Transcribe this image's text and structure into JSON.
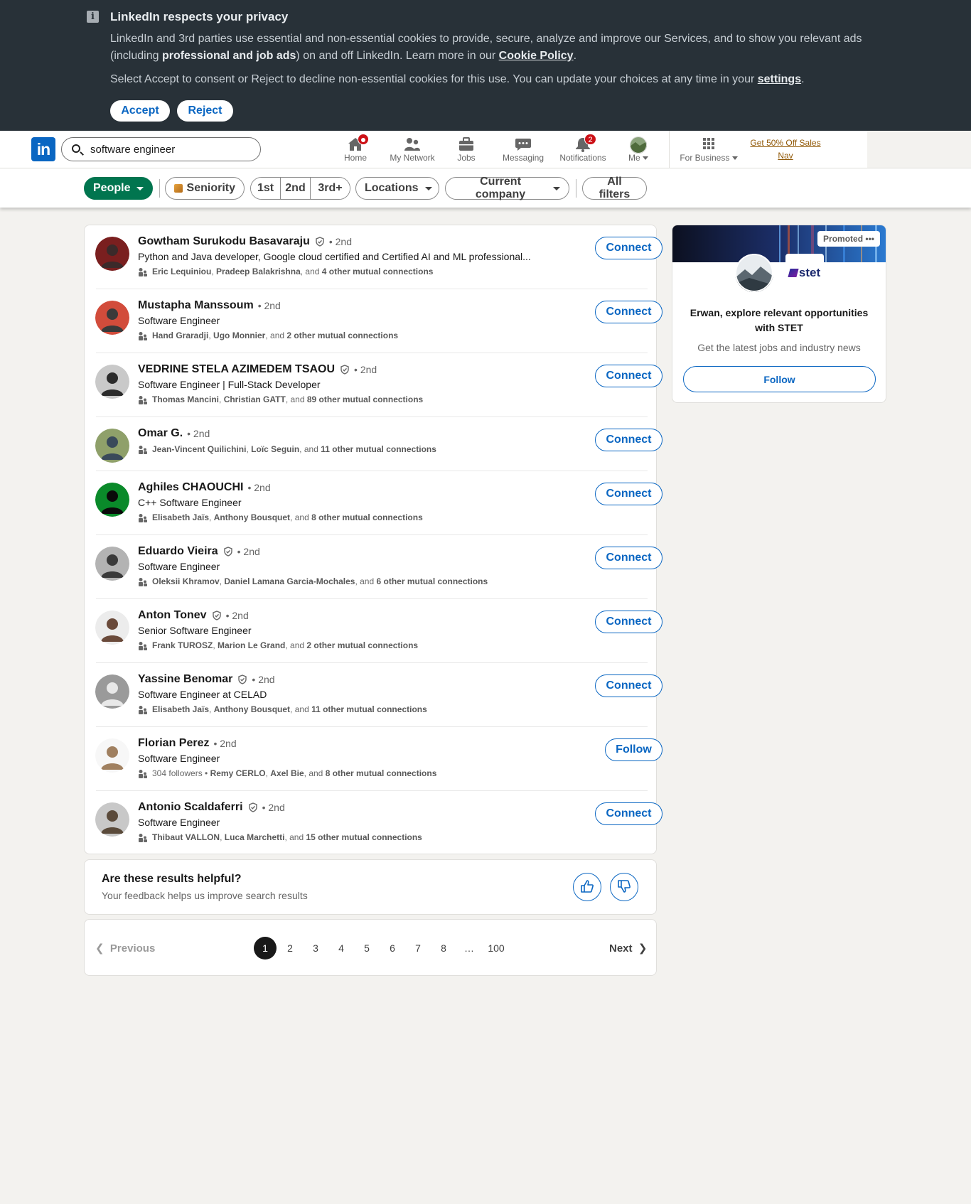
{
  "cookie_banner": {
    "title": "LinkedIn respects your privacy",
    "p1_a": "LinkedIn and 3rd parties use essential and non-essential cookies to provide, secure, analyze and improve our Services, and to show you relevant ads (including ",
    "p1_bold": "professional and job ads",
    "p1_b": ") on and off LinkedIn. Learn more in our ",
    "p1_link": "Cookie Policy",
    "p1_end": ".",
    "p2_a": "Select Accept to consent or Reject to decline non-essential cookies for this use. You can update your choices at any time in your ",
    "p2_link": "settings",
    "p2_end": ".",
    "accept": "Accept",
    "reject": "Reject"
  },
  "nav": {
    "logo": "in",
    "search_value": "software engineer",
    "items": [
      {
        "label": "Home",
        "icon": "home-icon"
      },
      {
        "label": "My Network",
        "icon": "network-icon"
      },
      {
        "label": "Jobs",
        "icon": "jobs-icon"
      },
      {
        "label": "Messaging",
        "icon": "messaging-icon"
      },
      {
        "label": "Notifications",
        "icon": "bell-icon",
        "badge": "2"
      },
      {
        "label": "Me",
        "icon": "avatar"
      },
      {
        "label": "For Business",
        "icon": "grid-icon"
      }
    ],
    "promo_line1": "Get 50% Off Sales",
    "promo_line2": "Nav",
    "badge_color": "#cc1016"
  },
  "filters": {
    "people": "People",
    "seniority": "Seniority",
    "first": "1st",
    "second": "2nd",
    "third": "3rd+",
    "locations": "Locations",
    "current_company": "Current company",
    "all_filters": "All filters"
  },
  "results": [
    {
      "name": "Gowtham Surukodu Basavaraju",
      "verified": true,
      "degree": "• 2nd",
      "headline": "Python and Java developer, Google cloud certified and Certified AI and ML professional...",
      "m1": "Eric Lequiniou",
      "m2": "Pradeep Balakrishna",
      "m_rest": "4 other mutual connections",
      "action": "Connect"
    },
    {
      "name": "Mustapha Manssoum",
      "verified": false,
      "degree": "• 2nd",
      "headline": "Software Engineer",
      "m1": "Hand Graradji",
      "m2": "Ugo Monnier",
      "m_rest": "2 other mutual connections",
      "action": "Connect"
    },
    {
      "name": "VEDRINE STELA AZIMEDEM TSAOU",
      "verified": true,
      "degree": "• 2nd",
      "headline": "Software Engineer | Full-Stack Developer",
      "m1": "Thomas Mancini",
      "m2": "Christian GATT",
      "m_rest": "89 other mutual connections",
      "action": "Connect"
    },
    {
      "name": "Omar G.",
      "verified": false,
      "degree": "• 2nd",
      "headline": "",
      "m1": "Jean-Vincent Quilichini",
      "m2": "Loïc Seguin",
      "m_rest": "11 other mutual connections",
      "action": "Connect"
    },
    {
      "name": "Aghiles CHAOUCHI",
      "verified": false,
      "degree": "• 2nd",
      "headline": "C++ Software Engineer",
      "m1": "Elisabeth Jaïs",
      "m2": "Anthony Bousquet",
      "m_rest": "8 other mutual connections",
      "action": "Connect"
    },
    {
      "name": "Eduardo Vieira",
      "verified": true,
      "degree": "• 2nd",
      "headline": "Software Engineer",
      "m1": "Oleksii Khramov",
      "m2": "Daniel Lamana Garcia-Mochales",
      "m_rest": "6 other mutual connections",
      "action": "Connect"
    },
    {
      "name": "Anton Tonev",
      "verified": true,
      "degree": "• 2nd",
      "headline": "Senior Software Engineer",
      "m1": "Frank TUROSZ",
      "m2": "Marion Le Grand",
      "m_rest": "2 other mutual connections",
      "action": "Connect"
    },
    {
      "name": "Yassine Benomar",
      "verified": true,
      "degree": "• 2nd",
      "headline": "Software Engineer at CELAD",
      "m1": "Elisabeth Jaïs",
      "m2": "Anthony Bousquet",
      "m_rest": "11 other mutual connections",
      "action": "Connect"
    },
    {
      "name": "Florian Perez",
      "verified": false,
      "degree": "• 2nd",
      "headline": "Software Engineer",
      "followers": "304 followers",
      "m1": "Remy CERLO",
      "m2": "Axel Bie",
      "m_rest": "8 other mutual connections",
      "action": "Follow"
    },
    {
      "name": "Antonio Scaldaferri",
      "verified": true,
      "degree": "• 2nd",
      "headline": "Software Engineer",
      "m1": "Thibaut VALLON",
      "m2": "Luca Marchetti",
      "m_rest": "15 other mutual connections",
      "action": "Connect"
    }
  ],
  "feedback": {
    "title": "Are these results helpful?",
    "subtitle": "Your feedback helps us improve search results"
  },
  "pagination": {
    "previous": "Previous",
    "next": "Next",
    "pages": [
      "1",
      "2",
      "3",
      "4",
      "5",
      "6",
      "7",
      "8",
      "…",
      "100"
    ],
    "current": "1"
  },
  "ad": {
    "promoted": "Promoted",
    "brand": "stet",
    "title": "Erwan, explore relevant opportunities with STET",
    "subtitle": "Get the latest jobs and industry news",
    "follow": "Follow"
  },
  "colors": {
    "accent": "#0a66c2",
    "filter_green": "#01754f",
    "cookie_bg": "#283138"
  }
}
